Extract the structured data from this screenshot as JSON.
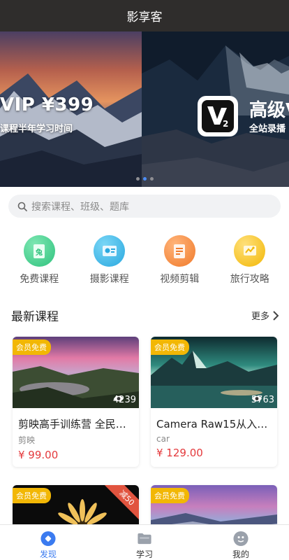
{
  "app": {
    "title": "影享客"
  },
  "banner": {
    "slide_left": {
      "title": "VIP ¥399",
      "subtitle": "课程半年学习时间"
    },
    "slide_right": {
      "title": "高级V",
      "subtitle": "全站录播"
    },
    "dots_count": 3,
    "active_dot": 1
  },
  "search": {
    "placeholder": "搜索课程、班级、题库"
  },
  "categories": [
    {
      "label": "免费课程",
      "icon": "free-course-icon",
      "color": "#3ecf8e"
    },
    {
      "label": "摄影课程",
      "icon": "photo-course-icon",
      "color": "#3bb7e8"
    },
    {
      "label": "视频剪辑",
      "icon": "video-edit-icon",
      "color": "#f5842a"
    },
    {
      "label": "旅行攻略",
      "icon": "travel-guide-icon",
      "color": "#f5c21b"
    }
  ],
  "section": {
    "title": "最新课程",
    "more_label": "更多"
  },
  "courses": [
    {
      "badge": "会员免费",
      "views": "4239",
      "title": "剪映高手训练营 全民…",
      "category": "剪映",
      "price": "¥ 99.00"
    },
    {
      "badge": "会员免费",
      "views": "5763",
      "title": "Camera Raw15从入…",
      "category": "car",
      "price": "¥ 129.00"
    },
    {
      "badge": "会员免费",
      "ribbon": "减50"
    },
    {
      "badge": "会员免费"
    }
  ],
  "tabbar": {
    "items": [
      {
        "label": "发现",
        "active": true
      },
      {
        "label": "学习",
        "active": false
      },
      {
        "label": "我的",
        "active": false
      }
    ]
  },
  "colors": {
    "accent": "#3b7bf0",
    "price": "#e4393c",
    "badge": "#f2b705",
    "titlebar": "#2f2d2c"
  }
}
